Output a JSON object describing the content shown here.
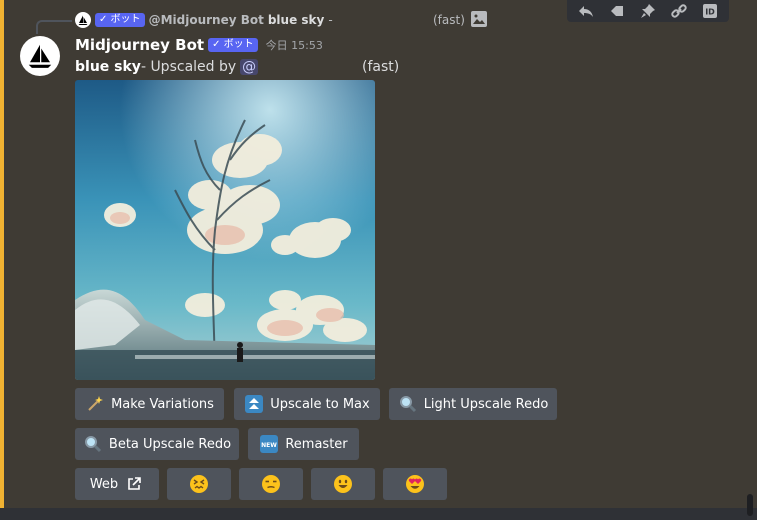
{
  "reply": {
    "bot_badge": "✓ ボット",
    "author": "@Midjourney Bot",
    "prompt": "blue sky",
    "dash": "-",
    "fast": "(fast)"
  },
  "message": {
    "author": "Midjourney Bot",
    "bot_badge": "✓ ボット",
    "timestamp": "今日 15:53",
    "prompt": "blue sky",
    "suffix": " - Upscaled by ",
    "mention": "@",
    "fast": "(fast)"
  },
  "buttons": {
    "make_variations": "Make Variations",
    "upscale_to_max": "Upscale to Max",
    "light_upscale_redo": "Light Upscale Redo",
    "beta_upscale_redo": "Beta Upscale Redo",
    "remaster": "Remaster",
    "web": "Web"
  },
  "icons": {
    "toolbar": [
      "reply-icon",
      "tag-icon",
      "pin-icon",
      "link-icon",
      "id-icon"
    ],
    "reactions": [
      "confounded-face-icon",
      "unamused-face-icon",
      "smiley-face-icon",
      "heart-eyes-face-icon"
    ]
  },
  "colors": {
    "background": "#3f3b34",
    "mention_highlight": "#f0b232",
    "button": "#4f545c",
    "badge": "#5865f2"
  }
}
